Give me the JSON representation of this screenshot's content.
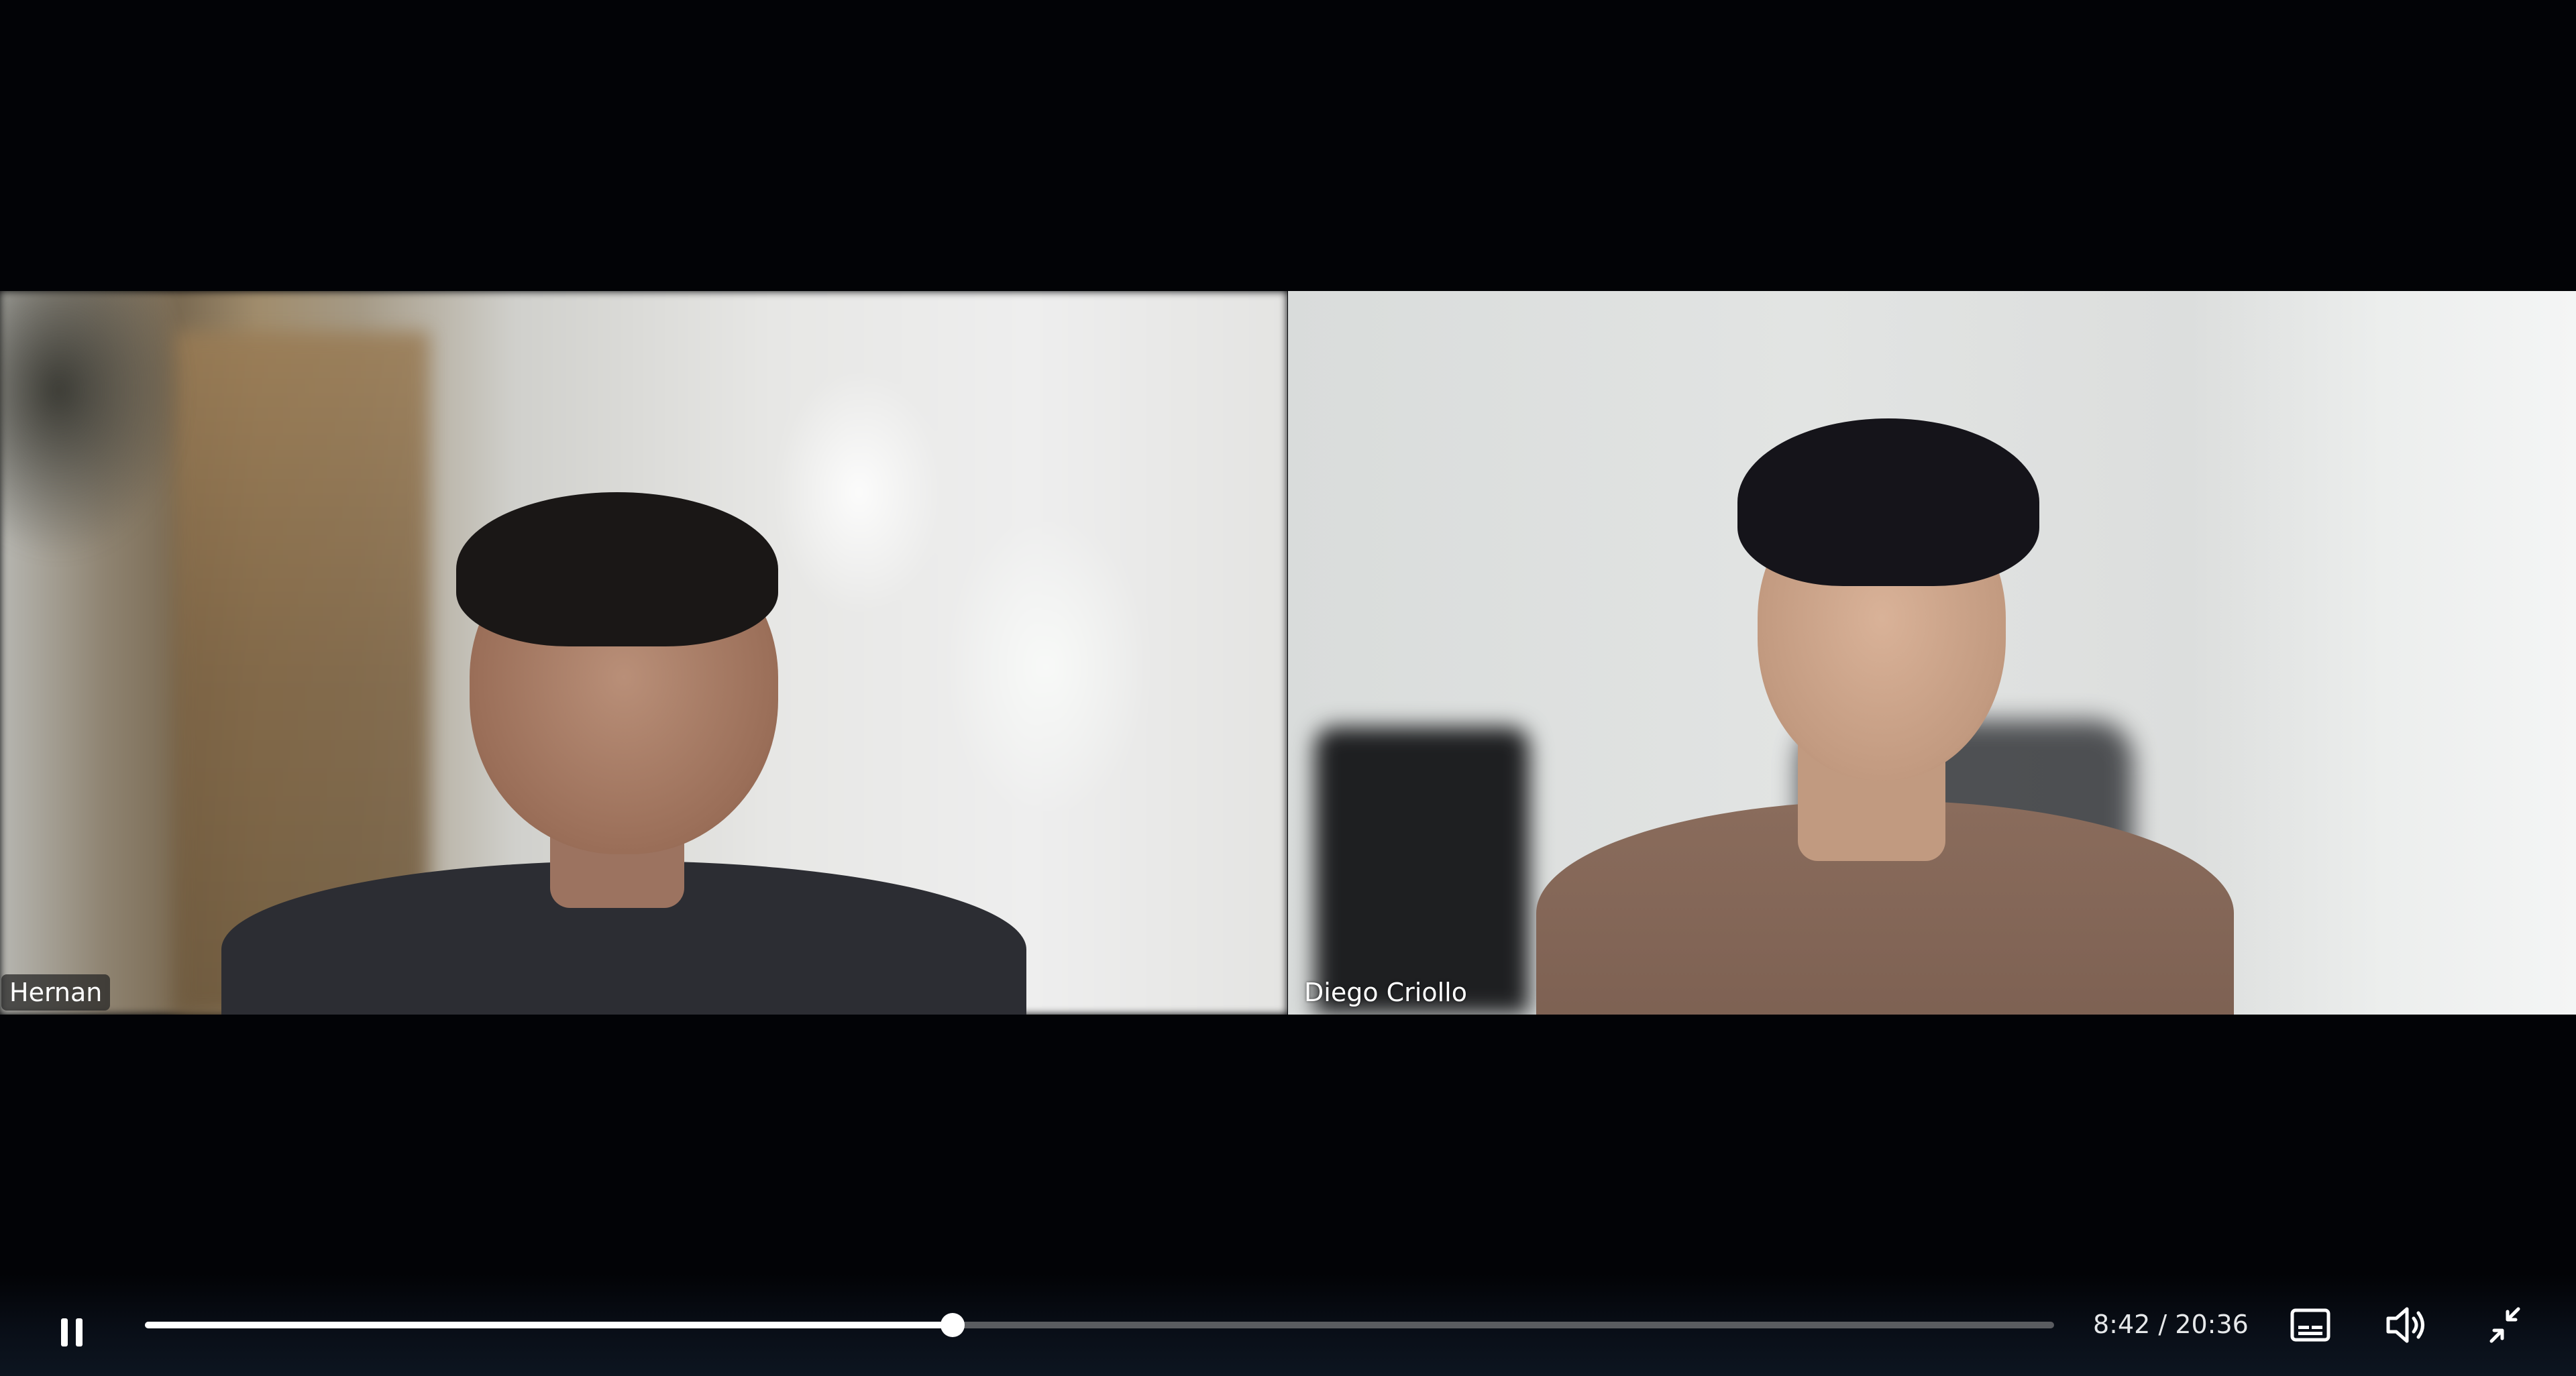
{
  "participants": [
    {
      "name": "Hernan"
    },
    {
      "name": "Diego Criollo"
    }
  ],
  "player": {
    "state": "playing",
    "current_time": "8:42",
    "duration": "20:36",
    "time_display": "8:42 / 20:36",
    "progress_fraction": 0.4231
  },
  "controls": {
    "pause_icon": "pause-icon",
    "captions_icon": "captions-icon",
    "volume_icon": "volume-icon",
    "exit_fullscreen_icon": "exit-fullscreen-icon"
  },
  "colors": {
    "background": "#020306",
    "control_bar": "#0d1520",
    "seek_track": "#5a5c60",
    "seek_filled": "#ffffff"
  }
}
